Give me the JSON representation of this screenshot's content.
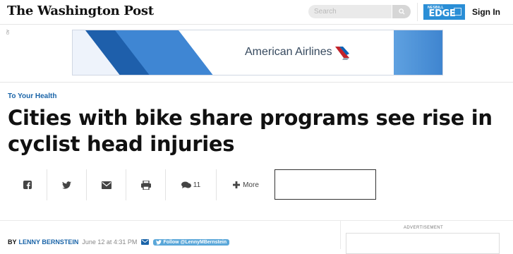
{
  "header": {
    "logo_text": "The Washington Post",
    "search_placeholder": "Search",
    "edge_brand": {
      "prefix": "NESBILL",
      "name": "EDGE",
      "color": "#2a8ed6"
    },
    "sign_in_label": "Sign In"
  },
  "ad": {
    "tag": "AD",
    "brand": "American Airlines"
  },
  "article": {
    "kicker": "To Your Health",
    "headline": "Cities with bike share programs see rise in cyclist head injuries",
    "share_bar": {
      "comments_count": "11",
      "more_label": "More"
    },
    "byline": {
      "by": "BY",
      "author": "LENNY BERNSTEIN",
      "date": "June 12 at 4:31 PM",
      "follow_label": "Follow @LennyMBernstein"
    }
  },
  "sidebar": {
    "advertisement_label": "ADVERTISEMENT"
  },
  "colors": {
    "link_blue": "#1a64a8",
    "follow_blue": "#5aa7d9"
  }
}
